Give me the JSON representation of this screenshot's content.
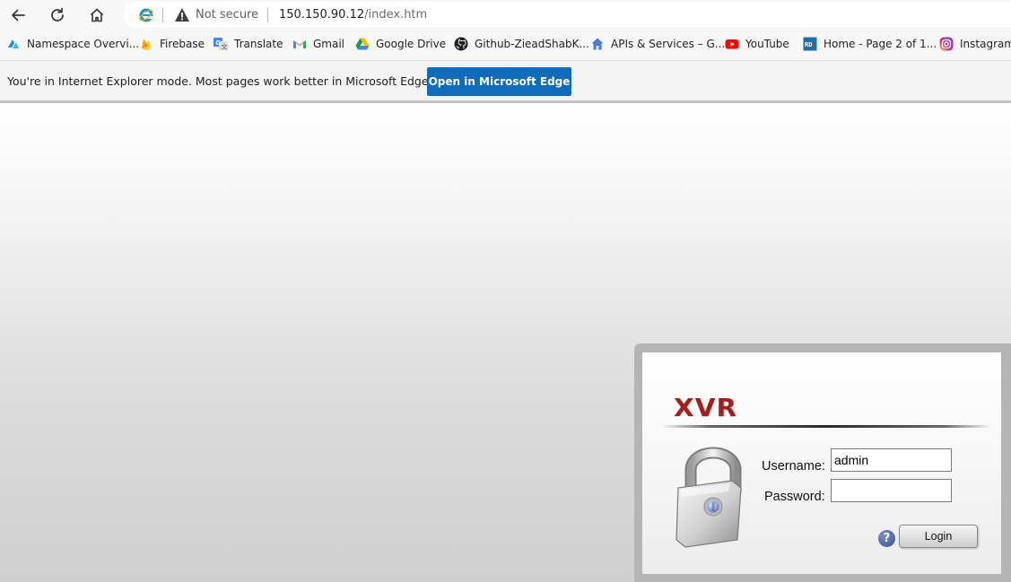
{
  "browser": {
    "security_label": "Not secure",
    "url_host": "150.150.90.12",
    "url_path": "/index.htm"
  },
  "bookmarks": [
    {
      "label": "Namespace Overvi...",
      "icon": "azure-icon"
    },
    {
      "label": "Firebase",
      "icon": "firebase-icon"
    },
    {
      "label": "Translate",
      "icon": "translate-icon"
    },
    {
      "label": "Gmail",
      "icon": "gmail-icon"
    },
    {
      "label": "Google Drive",
      "icon": "google-drive-icon"
    },
    {
      "label": "Github-ZieadShabK...",
      "icon": "github-icon"
    },
    {
      "label": "APIs & Services – G...",
      "icon": "apis-icon"
    },
    {
      "label": "YouTube",
      "icon": "youtube-icon"
    },
    {
      "label": "Home - Page 2 of 1...",
      "icon": "rd-icon"
    },
    {
      "label": "Instagram",
      "icon": "instagram-icon"
    }
  ],
  "ie_banner": {
    "message": "You're in Internet Explorer mode. Most pages work better in Microsoft Edge.",
    "button": "Open in Microsoft Edge"
  },
  "login": {
    "logo": "XVR",
    "username_label": "Username:",
    "username_value": "admin",
    "password_label": "Password:",
    "password_value": "",
    "help_symbol": "?",
    "login_button": "Login"
  },
  "colors": {
    "edge_button": "#0f6cbd",
    "logo_red": "#a71c1c"
  }
}
